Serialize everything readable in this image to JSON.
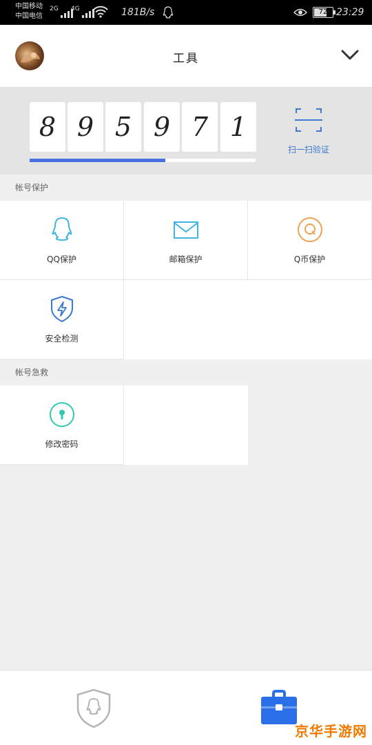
{
  "status_bar": {
    "carrier1": "中国移动",
    "carrier2": "中国电信",
    "net1": "2G",
    "net2": "4G",
    "speed": "181B/s",
    "battery": "72",
    "battery_level": 0.72,
    "time": "23:29"
  },
  "header": {
    "title": "工具",
    "avatar_icon": "user-avatar",
    "menu_icon": "chevron-down-icon"
  },
  "token": {
    "digits": [
      "8",
      "9",
      "5",
      "9",
      "7",
      "1"
    ],
    "progress": 0.6,
    "progress_color": "#4a6fe0",
    "scan_label": "扫一扫验证"
  },
  "sections": [
    {
      "title": "帐号保护",
      "items": [
        {
          "label": "QQ保护",
          "icon": "qq-penguin-icon",
          "color": "#3fb5e0"
        },
        {
          "label": "邮箱保护",
          "icon": "mail-icon",
          "color": "#3fb5e0"
        },
        {
          "label": "Q币保护",
          "icon": "q-coin-icon",
          "color": "#f0a050"
        },
        {
          "label": "安全检测",
          "icon": "shield-bolt-icon",
          "color": "#3b78d0"
        }
      ]
    },
    {
      "title": "帐号急救",
      "items": [
        {
          "label": "修改密码",
          "icon": "keyhole-icon",
          "color": "#2fc9b0"
        }
      ]
    }
  ],
  "bottom_nav": {
    "tabs": [
      {
        "name": "guard",
        "icon": "qq-shield-icon",
        "active": false
      },
      {
        "name": "tools",
        "icon": "toolbox-icon",
        "active": true,
        "color": "#2b6fe8"
      }
    ]
  },
  "watermark": "京华手游网"
}
